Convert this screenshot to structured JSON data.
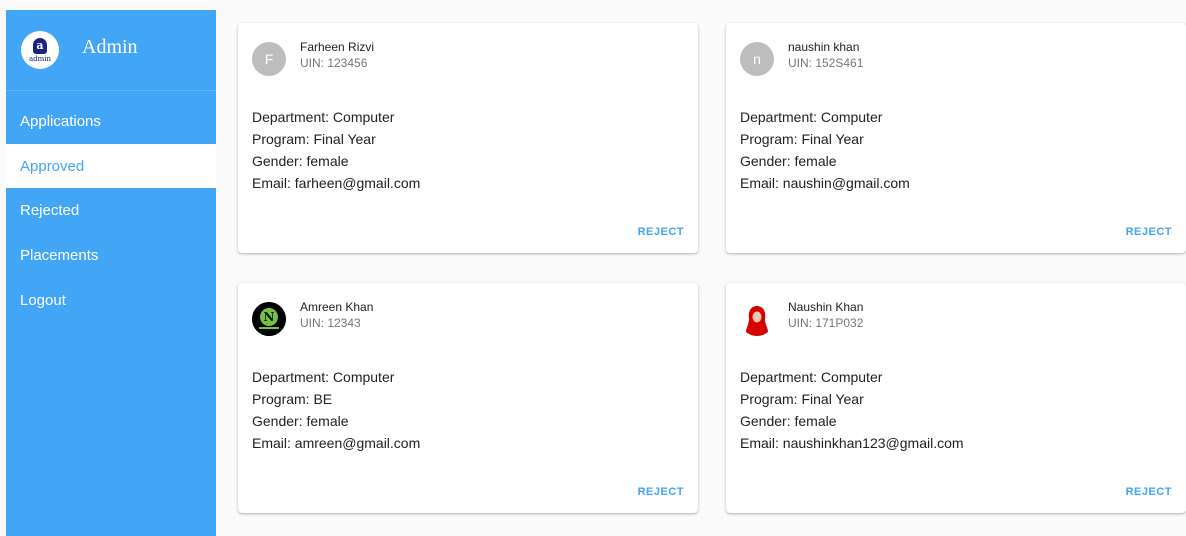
{
  "brand": {
    "title": "Admin",
    "logo_letter": "a",
    "logo_text": "admin"
  },
  "nav": [
    {
      "label": "Applications"
    },
    {
      "label": "Approved"
    },
    {
      "label": "Rejected"
    },
    {
      "label": "Placements"
    },
    {
      "label": "Logout"
    }
  ],
  "active_nav": "Approved",
  "colors": {
    "primary": "#42a5f5",
    "avatar_gray": "#bdbdbd"
  },
  "students": [
    {
      "avatar": "F",
      "name": "Farheen Rizvi",
      "uin": "UIN: 123456",
      "department": "Department: Computer",
      "program": "Program: Final Year",
      "gender": "Gender: female",
      "email": "Email: farheen@gmail.com",
      "action": "REJECT"
    },
    {
      "avatar": "n",
      "name": "naushin khan",
      "uin": "UIN: 152S461",
      "department": "Department: Computer",
      "program": "Program: Final Year",
      "gender": "Gender: female",
      "email": "Email: naushin@gmail.com",
      "action": "REJECT"
    },
    {
      "avatar": "photo",
      "name": "Amreen Khan",
      "uin": "UIN: 12343",
      "department": "Department: Computer",
      "program": "Program: BE",
      "gender": "Gender: female",
      "email": "Email: amreen@gmail.com",
      "action": "REJECT"
    },
    {
      "avatar": "photo",
      "name": "Naushin Khan",
      "uin": "UIN: 171P032",
      "department": "Department: Computer",
      "program": "Program: Final Year",
      "gender": "Gender: female",
      "email": "Email: naushinkhan123@gmail.com",
      "action": "REJECT"
    }
  ]
}
